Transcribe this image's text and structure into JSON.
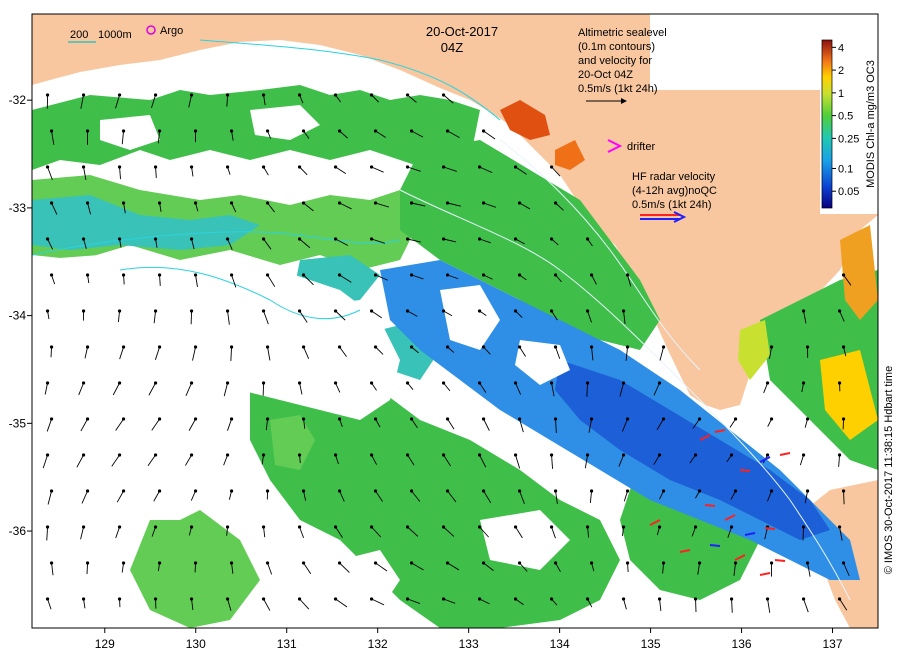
{
  "map": {
    "date": "20-Oct-2017",
    "time": "04Z",
    "x_ticks": [
      "129",
      "130",
      "131",
      "132",
      "133",
      "134",
      "135",
      "136",
      "137"
    ],
    "y_ticks": [
      "-32",
      "-33",
      "-34",
      "-35",
      "-36"
    ],
    "x_range": [
      128.2,
      137.5
    ],
    "y_range": [
      -36.9,
      -31.2
    ],
    "colors": {
      "land": "#f9c79f",
      "sea_nodata": "#ffffff",
      "green": "#3fbf4a",
      "light_green": "#63cc55",
      "blue": "#2f6fe0",
      "cyan": "#39c2b8",
      "contour": "#2bd3e0",
      "argo": "#e000e0",
      "drifter": "#ff00ff",
      "radar_red": "#ff2020",
      "radar_blue": "#2020ff"
    }
  },
  "legend": {
    "scale_200": "200",
    "scale_1000": "1000m",
    "argo": "Argo",
    "altimetry": [
      "Altimetric sealevel",
      "(0.1m contours)",
      "and velocity for",
      "20-Oct 04Z",
      "0.5m/s (1kt 24h)"
    ],
    "drifter": "drifter",
    "hf_radar": [
      "HF radar velocity",
      "(4-12h avg)noQC",
      "0.5m/s (1kt 24h)"
    ]
  },
  "colorbar": {
    "title": "MODIS Chl-a mg/m3 OC3",
    "ticks": [
      "4",
      "2",
      "1",
      "0.5",
      "0.25",
      "0.1",
      "0.05"
    ]
  },
  "credit": "© IMOS 30-Oct-2017 11:38:15 Hdbart time"
}
